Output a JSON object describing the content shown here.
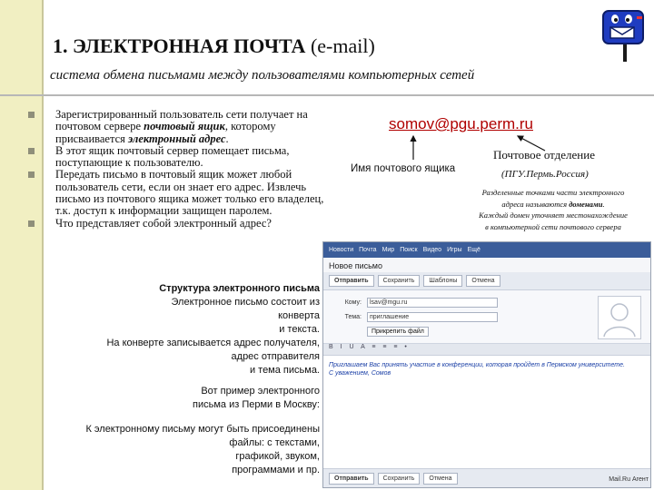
{
  "header": {
    "title_bold": "1. ЭЛЕКТРОННАЯ ПОЧТА",
    "title_rest": " (e-mail)",
    "subtitle": "система обмена письмами между пользователями компьютерных сетей"
  },
  "bullets": [
    {
      "a": "Зарегистрированный пользователь сети получает на почтовом сервере ",
      "b": "почтовый ящик",
      "c": ", которому присваивается ",
      "d": "электронный адрес",
      "e": "."
    },
    {
      "text": "В этот ящик почтовый сервер помещает письма, поступающие к пользователю."
    },
    {
      "text": "Передать письмо в почтовый ящик может любой пользователь сети, если он знает его адрес. Извлечь письмо из почтового ящика может только его владелец, т.к. доступ к информации защищен паролем."
    },
    {
      "text": "Что представляет собой электронный адрес?"
    }
  ],
  "address_diagram": {
    "email": "somov@pgu.perm.ru",
    "post_office": "Почтовое отделение",
    "mailbox_name": "Имя почтового ящика",
    "post_office_example": "(ПГУ.Пермь.Россия)",
    "domains_line1": "Разделенные точками части электронного",
    "domains_line2a": "адреса называются ",
    "domains_line2b": "доменами",
    "domains_line2c": ".",
    "domains_line3": "Каждый домен уточняет местонахождение",
    "domains_line4": "в компьютерной сети почтового сервера"
  },
  "structure": {
    "heading": "Структура электронного письма",
    "lines": [
      "Электронное письмо состоит из",
      "конверта",
      "и текста.",
      "На конверте записывается адрес получателя,",
      "адрес отправителя",
      "и тема письма."
    ],
    "example_lines": [
      "Вот пример электронного",
      "письма из Перми в Москву:"
    ],
    "attach_lines": [
      "К электронному письму могут быть присоединены",
      "файлы: с текстами,",
      "графикой, звуком,",
      "программами и пр."
    ]
  },
  "mail_window": {
    "top_links": [
      "Новости",
      "Почта",
      "Мир",
      "Поиск",
      "Видео",
      "Игры",
      "Ещё"
    ],
    "title": "Новое письмо",
    "buttons": [
      "Отправить",
      "Сохранить",
      "Шаблоны",
      "Отмена"
    ],
    "to_label": "Кому:",
    "to_value": "lsav@mgu.ru",
    "subject_label": "Тема:",
    "subject_value": "приглашение",
    "attach_label": "Прикрепить файл",
    "toolbar_icons": "B I U A ≡ ≡ ≡ •",
    "body_line1": "Приглашаем Вас принять участие в конференции, которая пройдет в Пермском университете.",
    "body_line2": "С уважением, Сомов",
    "send_button": "Отправить",
    "brand": "Mail.Ru Агент"
  },
  "colors": {
    "accent_bar": "#f1efc2",
    "email_red": "#b00000",
    "mail_header": "#3b5d9a"
  }
}
